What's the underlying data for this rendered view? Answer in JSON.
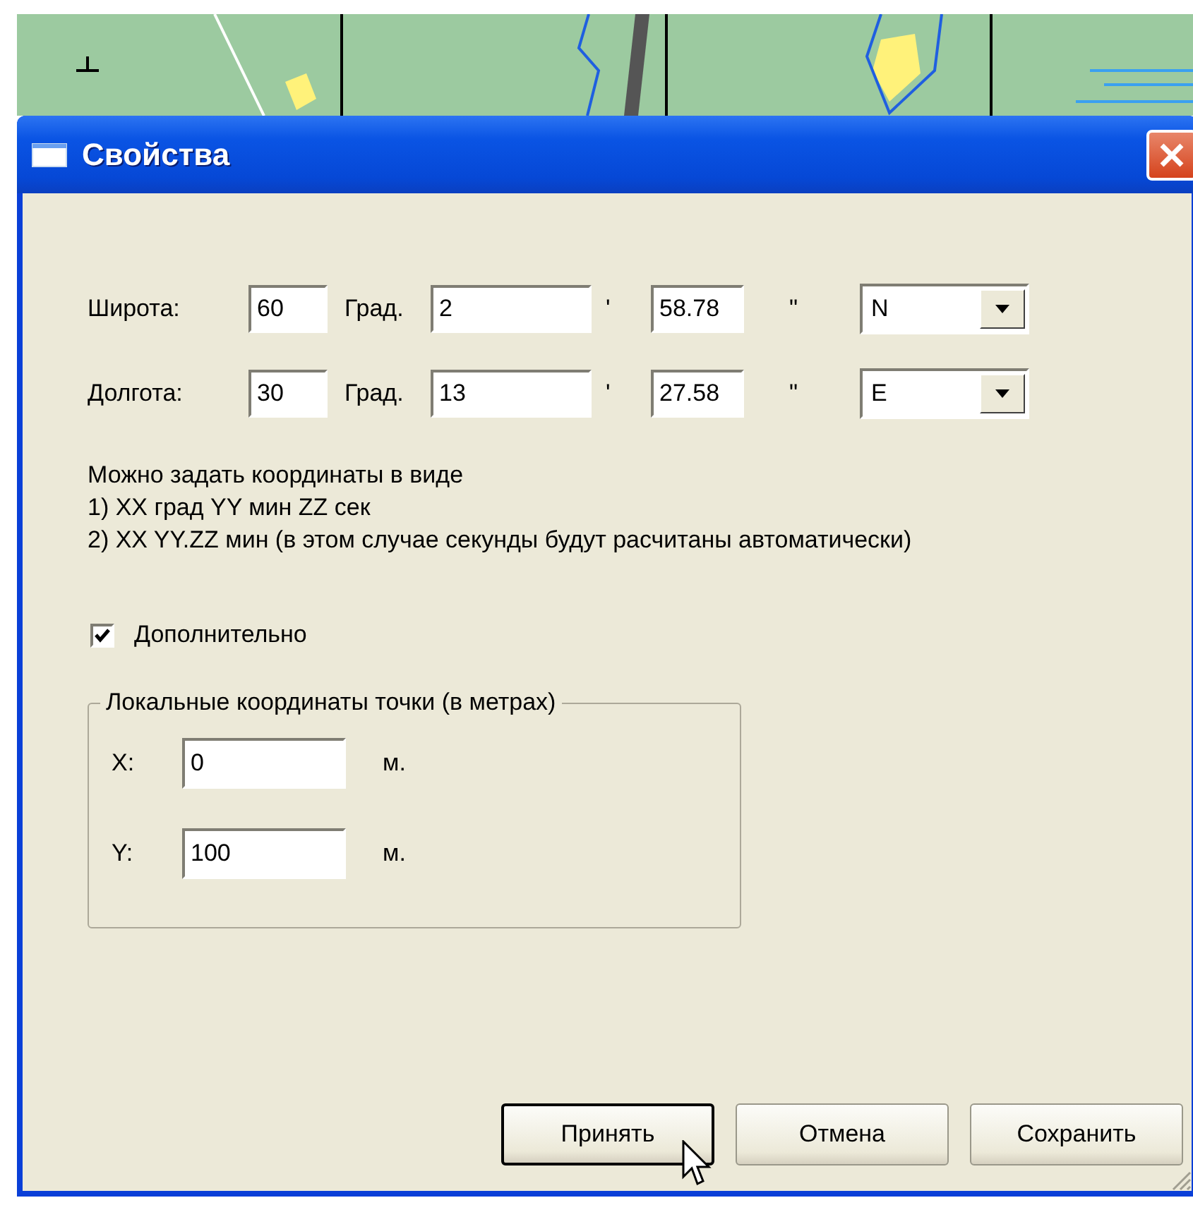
{
  "window": {
    "title": "Свойства"
  },
  "coordinates": [
    {
      "label": "Широта:",
      "degrees": "60",
      "degrees_unit": "Град.",
      "minutes": "2",
      "minutes_mark": "'",
      "seconds": "58.78",
      "seconds_mark": "\"",
      "hemisphere": "N"
    },
    {
      "label": "Долгота:",
      "degrees": "30",
      "degrees_unit": "Град.",
      "minutes": "13",
      "minutes_mark": "'",
      "seconds": "27.58",
      "seconds_mark": "\"",
      "hemisphere": "E"
    }
  ],
  "hint_lines": [
    "Можно задать координаты в виде",
    "1) XX град YY мин ZZ сек",
    "2) XX YY.ZZ мин (в этом случае секунды будут расчитаны автоматически)"
  ],
  "extra": {
    "label": "Дополнительно",
    "checked": true
  },
  "local_group": {
    "title": "Локальные координаты точки (в метрах)",
    "rows": [
      {
        "label": "X:",
        "value": "0",
        "unit": "м."
      },
      {
        "label": "Y:",
        "value": "100",
        "unit": "м."
      }
    ]
  },
  "buttons": [
    {
      "label": "Принять",
      "default": true
    },
    {
      "label": "Отмена",
      "default": false
    },
    {
      "label": "Сохранить",
      "default": false
    }
  ]
}
